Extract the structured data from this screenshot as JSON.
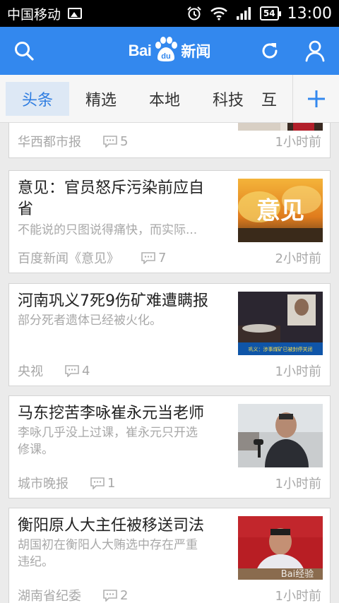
{
  "status_bar": {
    "carrier": "中国移动",
    "battery": "54",
    "time": "13:00"
  },
  "header": {
    "logo_bai": "Bai",
    "logo_du": "du",
    "logo_xinwen": "新闻",
    "brand_color": "#3388ee"
  },
  "tabs": {
    "items": [
      "头条",
      "精选",
      "本地",
      "科技",
      "互"
    ],
    "active_index": 0,
    "add_icon": "plus-icon"
  },
  "partial_article": {
    "source": "华西都市报",
    "comments": "5",
    "time": "1小时前"
  },
  "articles": [
    {
      "title_line1": "意见：官员怒斥污染前应自",
      "title_line2": "省",
      "summary": "不能说的只图说得痛快，而实际...",
      "source": "百度新闻《意见》",
      "comments": "7",
      "time": "2小时前",
      "thumb_text": "意见"
    },
    {
      "title_line1": "河南巩义7死9伤矿难遭瞒报",
      "summary": "部分死者遗体已经被火化。",
      "source": "央视",
      "comments": "4",
      "time": "1小时前",
      "thumb_text": "巩义：涉事煤矿已被封停关闭"
    },
    {
      "title_line1": "马东挖苦李咏崔永元当老师",
      "summary_line1": "李咏几乎没上过课，崔永元只开选",
      "summary_line2": "修课。",
      "source": "城市晚报",
      "comments": "1",
      "time": "1小时前"
    },
    {
      "title_line1": "衡阳原人大主任被移送司法",
      "summary_line1": "胡国初在衡阳人大贿选中存在严重",
      "summary_line2": "违纪。",
      "source": "湖南省纪委",
      "comments": "2",
      "time": "1小时前",
      "watermark": "Bai经验"
    }
  ]
}
